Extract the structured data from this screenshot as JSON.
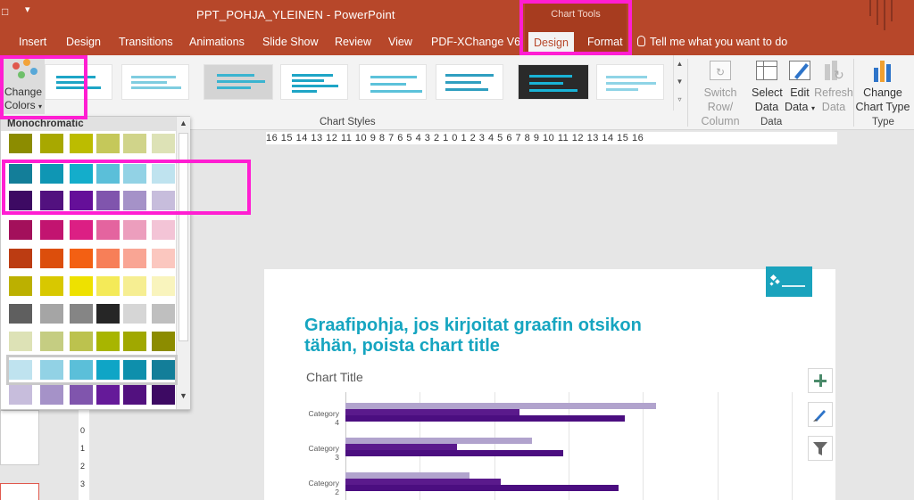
{
  "app": {
    "qat_icon": "save-icon",
    "doc_title": "PPT_POHJA_YLEINEN  -  PowerPoint",
    "chart_tools_label": "Chart Tools"
  },
  "tabs": [
    {
      "label": "Insert"
    },
    {
      "label": "Design"
    },
    {
      "label": "Transitions"
    },
    {
      "label": "Animations"
    },
    {
      "label": "Slide Show"
    },
    {
      "label": "Review"
    },
    {
      "label": "View"
    },
    {
      "label": "PDF-XChange V6"
    },
    {
      "label": "Design"
    },
    {
      "label": "Format"
    }
  ],
  "tell_me": "Tell me what you want to do",
  "ribbon": {
    "change_colors": {
      "line1": "Change",
      "line2": "Colors"
    },
    "chart_styles_label": "Chart Styles",
    "data_group_label": "Data",
    "type_group_label": "Type",
    "switch_row_col": {
      "line1": "Switch Row/",
      "line2": "Column"
    },
    "select_data": {
      "line1": "Select",
      "line2": "Data"
    },
    "edit_data": {
      "line1": "Edit",
      "line2": "Data"
    },
    "refresh_data": {
      "line1": "Refresh",
      "line2": "Data"
    },
    "change_chart_type": {
      "line1": "Change",
      "line2": "Chart Type"
    }
  },
  "colors_dropdown": {
    "header": "Monochromatic",
    "palettes": [
      [
        "#8c8c00",
        "#a8a800",
        "#bcbc00",
        "#c5c85a",
        "#d0d48a",
        "#dde2b6"
      ],
      [
        "#137e99",
        "#0f96b4",
        "#14adcb",
        "#5bbfd9",
        "#92d2e5",
        "#bfe3ef"
      ],
      [
        "#3d0a63",
        "#52117f",
        "#650f99",
        "#8055ad",
        "#a592c8",
        "#c7bddc"
      ],
      [
        "#a3105b",
        "#c21470",
        "#dc1f84",
        "#e4649f",
        "#ec9ebd",
        "#f3c4d6"
      ],
      [
        "#bc3c12",
        "#dc4e0c",
        "#f36013",
        "#f77f58",
        "#f9a594",
        "#fbc7bf"
      ],
      [
        "#bcb000",
        "#d8c800",
        "#eee100",
        "#f4ea58",
        "#f6ee92",
        "#f9f4bd"
      ],
      [
        "#5f5f5f",
        "#a5a5a5",
        "#858585",
        "#262626",
        "#d6d6d6",
        "#bfbfbf"
      ],
      [
        "#dde2b6",
        "#c5cd82",
        "#bcc24e",
        "#a8b500",
        "#a0a800",
        "#8c8c00"
      ],
      [
        "#bfe3ef",
        "#92d2e5",
        "#5bbfd9",
        "#0fa5c6",
        "#0e8fac",
        "#137e99"
      ],
      [
        "#c7bddc",
        "#a592c8",
        "#8055ad",
        "#651a99",
        "#52117f",
        "#3d0a63"
      ]
    ]
  },
  "ruler_text": "16 15 14 13 12 11 10  9  8  7  6  5  4  3  2  1  0  1  2  3  4  5  6  7  8  9  10 11 12 13 14 15 16",
  "slide": {
    "title_line1": "Graafipohja, jos kirjoitat graafin otsikon",
    "title_line2": "tähän, poista chart title",
    "chart_title": "Chart Title"
  },
  "chart_data": {
    "type": "bar",
    "orientation": "horizontal",
    "title": "Chart Title",
    "categories": [
      "Category 4",
      "Category 3",
      "Category 2"
    ],
    "series": [
      {
        "color": "#b1a3cd",
        "values": [
          5.0,
          3.0,
          2.0
        ]
      },
      {
        "color": "#5a1a8c",
        "values": [
          2.8,
          1.8,
          2.5
        ]
      },
      {
        "color": "#4b0e80",
        "values": [
          4.5,
          3.5,
          4.4
        ]
      }
    ],
    "xlim": [
      0,
      6
    ],
    "grid": true,
    "legend": "none"
  },
  "side_buttons": [
    "plus-icon",
    "brush-icon",
    "filter-icon"
  ]
}
